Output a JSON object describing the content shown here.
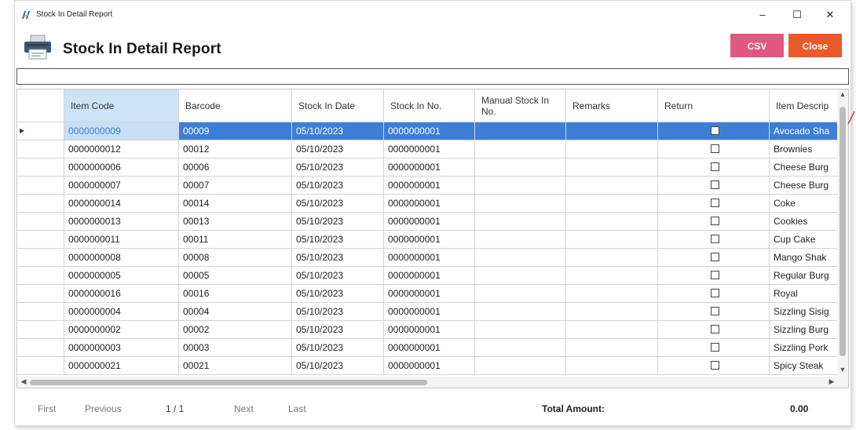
{
  "window": {
    "title": "Stock In Detail Report",
    "minimize_glyph": "–",
    "maximize_glyph": "☐",
    "close_glyph": "✕"
  },
  "header": {
    "title": "Stock In Detail Report",
    "icon": "printer-icon",
    "csv_label": "CSV",
    "close_label": "Close",
    "csv_color": "#e0577f",
    "close_color": "#ea5a2b"
  },
  "search": {
    "value": ""
  },
  "table": {
    "columns": [
      "Item Code",
      "Barcode",
      "Stock In Date",
      "Stock In No.",
      "Manual Stock In No.",
      "Remarks",
      "Return",
      "Item Descrip"
    ],
    "selected_row": 0,
    "selection_color": "#3d7fd6",
    "rows": [
      {
        "item_code": "0000000009",
        "barcode": "00009",
        "date": "05/10/2023",
        "stock_in_no": "0000000001",
        "manual": "",
        "remarks": "",
        "return": false,
        "desc": "Avocado Sha"
      },
      {
        "item_code": "0000000012",
        "barcode": "00012",
        "date": "05/10/2023",
        "stock_in_no": "0000000001",
        "manual": "",
        "remarks": "",
        "return": false,
        "desc": "Brownies"
      },
      {
        "item_code": "0000000006",
        "barcode": "00006",
        "date": "05/10/2023",
        "stock_in_no": "0000000001",
        "manual": "",
        "remarks": "",
        "return": false,
        "desc": "Cheese Burg"
      },
      {
        "item_code": "0000000007",
        "barcode": "00007",
        "date": "05/10/2023",
        "stock_in_no": "0000000001",
        "manual": "",
        "remarks": "",
        "return": false,
        "desc": "Cheese Burg"
      },
      {
        "item_code": "0000000014",
        "barcode": "00014",
        "date": "05/10/2023",
        "stock_in_no": "0000000001",
        "manual": "",
        "remarks": "",
        "return": false,
        "desc": "Coke"
      },
      {
        "item_code": "0000000013",
        "barcode": "00013",
        "date": "05/10/2023",
        "stock_in_no": "0000000001",
        "manual": "",
        "remarks": "",
        "return": false,
        "desc": "Cookies"
      },
      {
        "item_code": "0000000011",
        "barcode": "00011",
        "date": "05/10/2023",
        "stock_in_no": "0000000001",
        "manual": "",
        "remarks": "",
        "return": false,
        "desc": "Cup Cake"
      },
      {
        "item_code": "0000000008",
        "barcode": "00008",
        "date": "05/10/2023",
        "stock_in_no": "0000000001",
        "manual": "",
        "remarks": "",
        "return": false,
        "desc": "Mango Shak"
      },
      {
        "item_code": "0000000005",
        "barcode": "00005",
        "date": "05/10/2023",
        "stock_in_no": "0000000001",
        "manual": "",
        "remarks": "",
        "return": false,
        "desc": "Regular Burg"
      },
      {
        "item_code": "0000000016",
        "barcode": "00016",
        "date": "05/10/2023",
        "stock_in_no": "0000000001",
        "manual": "",
        "remarks": "",
        "return": false,
        "desc": "Royal"
      },
      {
        "item_code": "0000000004",
        "barcode": "00004",
        "date": "05/10/2023",
        "stock_in_no": "0000000001",
        "manual": "",
        "remarks": "",
        "return": false,
        "desc": "Sizzling Sisig"
      },
      {
        "item_code": "0000000002",
        "barcode": "00002",
        "date": "05/10/2023",
        "stock_in_no": "0000000001",
        "manual": "",
        "remarks": "",
        "return": false,
        "desc": "Sizzling Burg"
      },
      {
        "item_code": "0000000003",
        "barcode": "00003",
        "date": "05/10/2023",
        "stock_in_no": "0000000001",
        "manual": "",
        "remarks": "",
        "return": false,
        "desc": "Sizzling Pork"
      },
      {
        "item_code": "0000000021",
        "barcode": "00021",
        "date": "05/10/2023",
        "stock_in_no": "0000000001",
        "manual": "",
        "remarks": "",
        "return": false,
        "desc": "Spicy Steak"
      }
    ]
  },
  "pager": {
    "first": "First",
    "previous": "Previous",
    "info": "1 / 1",
    "next": "Next",
    "last": "Last"
  },
  "summary": {
    "total_label": "Total Amount:",
    "total_value": "0.00"
  }
}
